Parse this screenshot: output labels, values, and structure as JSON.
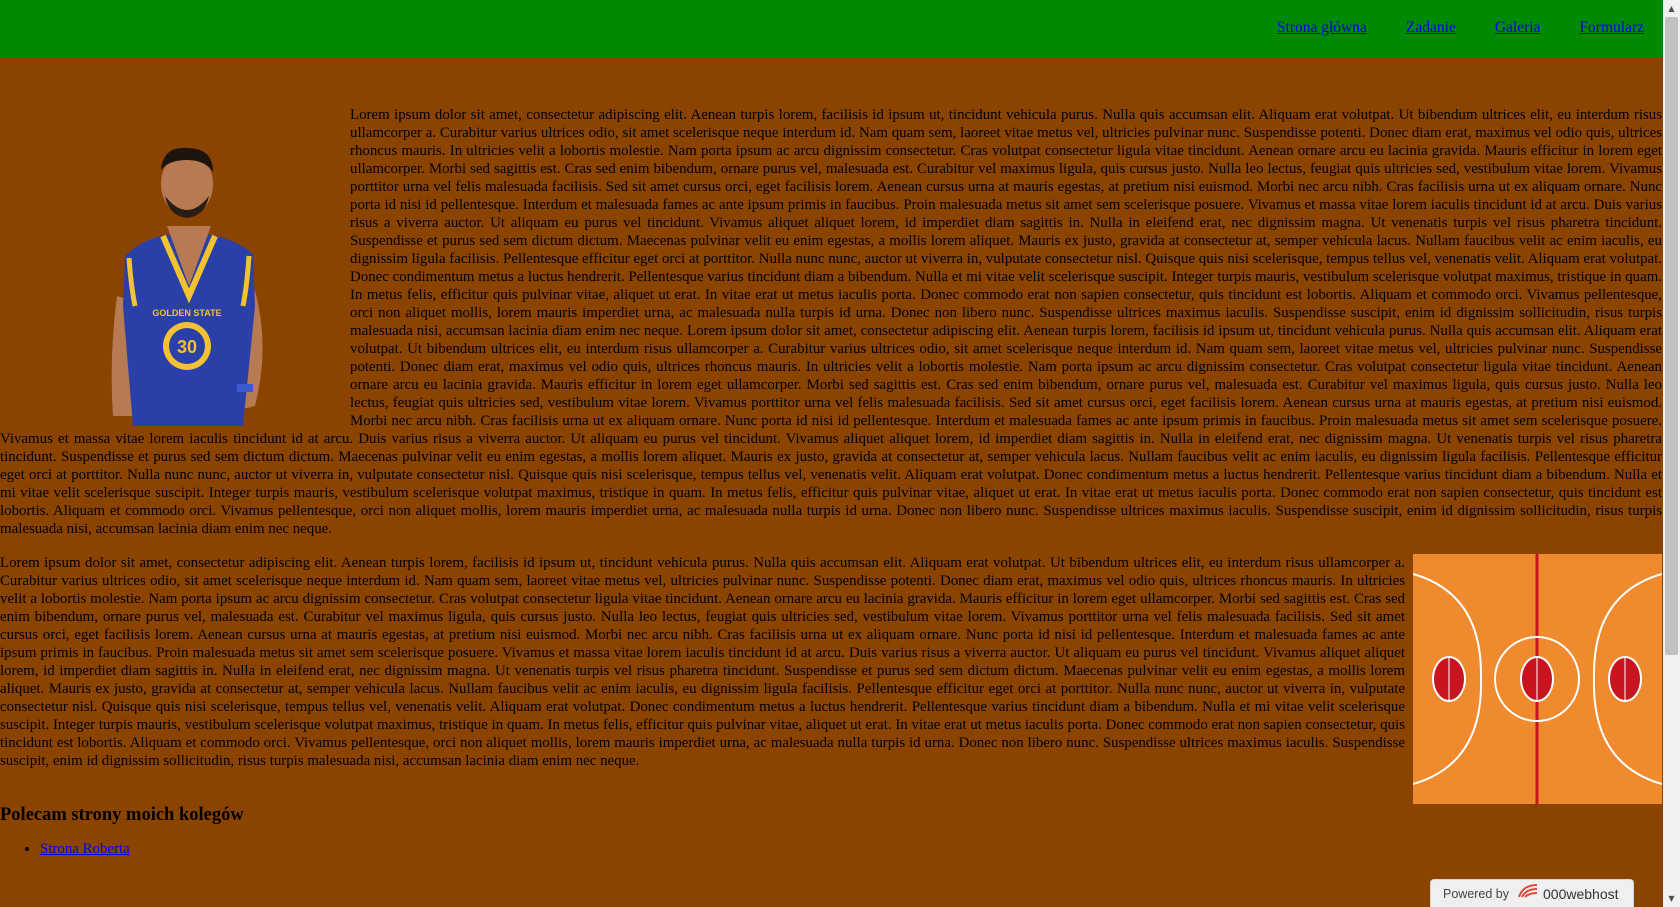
{
  "nav": {
    "items": [
      {
        "label": "Strona główna"
      },
      {
        "label": "Zadanie"
      },
      {
        "label": "Galeria"
      },
      {
        "label": "Formularz"
      }
    ]
  },
  "images": {
    "player_icon": "basketball-player-photo",
    "player_jersey_text": "GOLDEN STATE",
    "player_number": "30",
    "court_icon": "basketball-court-image"
  },
  "main": {
    "paragraph1": "Lorem ipsum dolor sit amet, consectetur adipiscing elit. Aenean turpis lorem, facilisis id ipsum ut, tincidunt vehicula purus. Nulla quis accumsan elit. Aliquam erat volutpat. Ut bibendum ultrices elit, eu interdum risus ullamcorper a. Curabitur varius ultrices odio, sit amet scelerisque neque interdum id. Nam quam sem, laoreet vitae metus vel, ultricies pulvinar nunc. Suspendisse potenti. Donec diam erat, maximus vel odio quis, ultrices rhoncus mauris. In ultricies velit a lobortis molestie. Nam porta ipsum ac arcu dignissim consectetur. Cras volutpat consectetur ligula vitae tincidunt. Aenean ornare arcu eu lacinia gravida. Mauris efficitur in lorem eget ullamcorper. Morbi sed sagittis est. Cras sed enim bibendum, ornare purus vel, malesuada est. Curabitur vel maximus ligula, quis cursus justo. Nulla leo lectus, feugiat quis ultricies sed, vestibulum vitae lorem. Vivamus porttitor urna vel felis malesuada facilisis. Sed sit amet cursus orci, eget facilisis lorem. Aenean cursus urna at mauris egestas, at pretium nisi euismod. Morbi nec arcu nibh. Cras facilisis urna ut ex aliquam ornare. Nunc porta id nisi id pellentesque. Interdum et malesuada fames ac ante ipsum primis in faucibus. Proin malesuada metus sit amet sem scelerisque posuere. Vivamus et massa vitae lorem iaculis tincidunt id at arcu. Duis varius risus a viverra auctor. Ut aliquam eu purus vel tincidunt. Vivamus aliquet aliquet lorem, id imperdiet diam sagittis in. Nulla in eleifend erat, nec dignissim magna. Ut venenatis turpis vel risus pharetra tincidunt. Suspendisse et purus sed sem dictum dictum. Maecenas pulvinar velit eu enim egestas, a mollis lorem aliquet. Mauris ex justo, gravida at consectetur at, semper vehicula lacus. Nullam faucibus velit ac enim iaculis, eu dignissim ligula facilisis. Pellentesque efficitur eget orci at porttitor. Nulla nunc nunc, auctor ut viverra in, vulputate consectetur nisl. Quisque quis nisi scelerisque, tempus tellus vel, venenatis velit. Aliquam erat volutpat. Donec condimentum metus a luctus hendrerit. Pellentesque varius tincidunt diam a bibendum. Nulla et mi vitae velit scelerisque suscipit. Integer turpis mauris, vestibulum scelerisque volutpat maximus, tristique in quam. In metus felis, efficitur quis pulvinar vitae, aliquet ut erat. In vitae erat ut metus iaculis porta. Donec commodo erat non sapien consectetur, quis tincidunt est lobortis. Aliquam et commodo orci. Vivamus pellentesque, orci non aliquet mollis, lorem mauris imperdiet urna, ac malesuada nulla turpis id urna. Donec non libero nunc. Suspendisse ultrices maximus iaculis. Suspendisse suscipit, enim id dignissim sollicitudin, risus turpis malesuada nisi, accumsan lacinia diam enim nec neque. Lorem ipsum dolor sit amet, consectetur adipiscing elit. Aenean turpis lorem, facilisis id ipsum ut, tincidunt vehicula purus. Nulla quis accumsan elit. Aliquam erat volutpat. Ut bibendum ultrices elit, eu interdum risus ullamcorper a. Curabitur varius ultrices odio, sit amet scelerisque neque interdum id. Nam quam sem, laoreet vitae metus vel, ultricies pulvinar nunc. Suspendisse potenti. Donec diam erat, maximus vel odio quis, ultrices rhoncus mauris. In ultricies velit a lobortis molestie. Nam porta ipsum ac arcu dignissim consectetur. Cras volutpat consectetur ligula vitae tincidunt. Aenean ornare arcu eu lacinia gravida. Mauris efficitur in lorem eget ullamcorper. Morbi sed sagittis est. Cras sed enim bibendum, ornare purus vel, malesuada est. Curabitur vel maximus ligula, quis cursus justo. Nulla leo lectus, feugiat quis ultricies sed, vestibulum vitae lorem. Vivamus porttitor urna vel felis malesuada facilisis. Sed sit amet cursus orci, eget facilisis lorem. Aenean cursus urna at mauris egestas, at pretium nisi euismod. Morbi nec arcu nibh. Cras facilisis urna ut ex aliquam ornare. Nunc porta id nisi id pellentesque. Interdum et malesuada fames ac ante ipsum primis in faucibus. Proin malesuada metus sit amet sem scelerisque posuere. Vivamus et massa vitae lorem iaculis tincidunt id at arcu. Duis varius risus a viverra auctor. Ut aliquam eu purus vel tincidunt. Vivamus aliquet aliquet lorem, id imperdiet diam sagittis in. Nulla in eleifend erat, nec dignissim magna. Ut venenatis turpis vel risus pharetra tincidunt. Suspendisse et purus sed sem dictum dictum. Maecenas pulvinar velit eu enim egestas, a mollis lorem aliquet. Mauris ex justo, gravida at consectetur at, semper vehicula lacus. Nullam faucibus velit ac enim iaculis, eu dignissim ligula facilisis. Pellentesque efficitur eget orci at porttitor. Nulla nunc nunc, auctor ut viverra in, vulputate consectetur nisl. Quisque quis nisi scelerisque, tempus tellus vel, venenatis velit. Aliquam erat volutpat. Donec condimentum metus a luctus hendrerit. Pellentesque varius tincidunt diam a bibendum. Nulla et mi vitae velit scelerisque suscipit. Integer turpis mauris, vestibulum scelerisque volutpat maximus, tristique in quam. In metus felis, efficitur quis pulvinar vitae, aliquet ut erat. In vitae erat ut metus iaculis porta. Donec commodo erat non sapien consectetur, quis tincidunt est lobortis. Aliquam et commodo orci. Vivamus pellentesque, orci non aliquet mollis, lorem mauris imperdiet urna, ac malesuada nulla turpis id urna. Donec non libero nunc. Suspendisse ultrices maximus iaculis. Suspendisse suscipit, enim id dignissim sollicitudin, risus turpis malesuada nisi, accumsan lacinia diam enim nec neque.",
    "paragraph2": "Lorem ipsum dolor sit amet, consectetur adipiscing elit. Aenean turpis lorem, facilisis id ipsum ut, tincidunt vehicula purus. Nulla quis accumsan elit. Aliquam erat volutpat. Ut bibendum ultrices elit, eu interdum risus ullamcorper a. Curabitur varius ultrices odio, sit amet scelerisque neque interdum id. Nam quam sem, laoreet vitae metus vel, ultricies pulvinar nunc. Suspendisse potenti. Donec diam erat, maximus vel odio quis, ultrices rhoncus mauris. In ultricies velit a lobortis molestie. Nam porta ipsum ac arcu dignissim consectetur. Cras volutpat consectetur ligula vitae tincidunt. Aenean ornare arcu eu lacinia gravida. Mauris efficitur in lorem eget ullamcorper. Morbi sed sagittis est. Cras sed enim bibendum, ornare purus vel, malesuada est. Curabitur vel maximus ligula, quis cursus justo. Nulla leo lectus, feugiat quis ultricies sed, vestibulum vitae lorem. Vivamus porttitor urna vel felis malesuada facilisis. Sed sit amet cursus orci, eget facilisis lorem. Aenean cursus urna at mauris egestas, at pretium nisi euismod. Morbi nec arcu nibh. Cras facilisis urna ut ex aliquam ornare. Nunc porta id nisi id pellentesque. Interdum et malesuada fames ac ante ipsum primis in faucibus. Proin malesuada metus sit amet sem scelerisque posuere. Vivamus et massa vitae lorem iaculis tincidunt id at arcu. Duis varius risus a viverra auctor. Ut aliquam eu purus vel tincidunt. Vivamus aliquet aliquet lorem, id imperdiet diam sagittis in. Nulla in eleifend erat, nec dignissim magna. Ut venenatis turpis vel risus pharetra tincidunt. Suspendisse et purus sed sem dictum dictum. Maecenas pulvinar velit eu enim egestas, a mollis lorem aliquet. Mauris ex justo, gravida at consectetur at, semper vehicula lacus. Nullam faucibus velit ac enim iaculis, eu dignissim ligula facilisis. Pellentesque efficitur eget orci at porttitor. Nulla nunc nunc, auctor ut viverra in, vulputate consectetur nisl. Quisque quis nisi scelerisque, tempus tellus vel, venenatis velit. Aliquam erat volutpat. Donec condimentum metus a luctus hendrerit. Pellentesque varius tincidunt diam a bibendum. Nulla et mi vitae velit scelerisque suscipit. Integer turpis mauris, vestibulum scelerisque volutpat maximus, tristique in quam. In metus felis, efficitur quis pulvinar vitae, aliquet ut erat. In vitae erat ut metus iaculis porta. Donec commodo erat non sapien consectetur, quis tincidunt est lobortis. Aliquam et commodo orci. Vivamus pellentesque, orci non aliquet mollis, lorem mauris imperdiet urna, ac malesuada nulla turpis id urna. Donec non libero nunc. Suspendisse ultrices maximus iaculis. Suspendisse suscipit, enim id dignissim sollicitudin, risus turpis malesuada nisi, accumsan lacinia diam enim nec neque.",
    "friends_heading": "Polecam strony moich kolegów",
    "friends_links": [
      {
        "label": "Strona Roberta"
      }
    ]
  },
  "footer_badge": {
    "prefix": "Powered by",
    "brand": "000webhost"
  },
  "colors": {
    "page_background": "#8b4400",
    "topbar": "#008a00",
    "link": "#0000ee",
    "court_orange": "#f08a2e",
    "court_red": "#c8141e"
  }
}
